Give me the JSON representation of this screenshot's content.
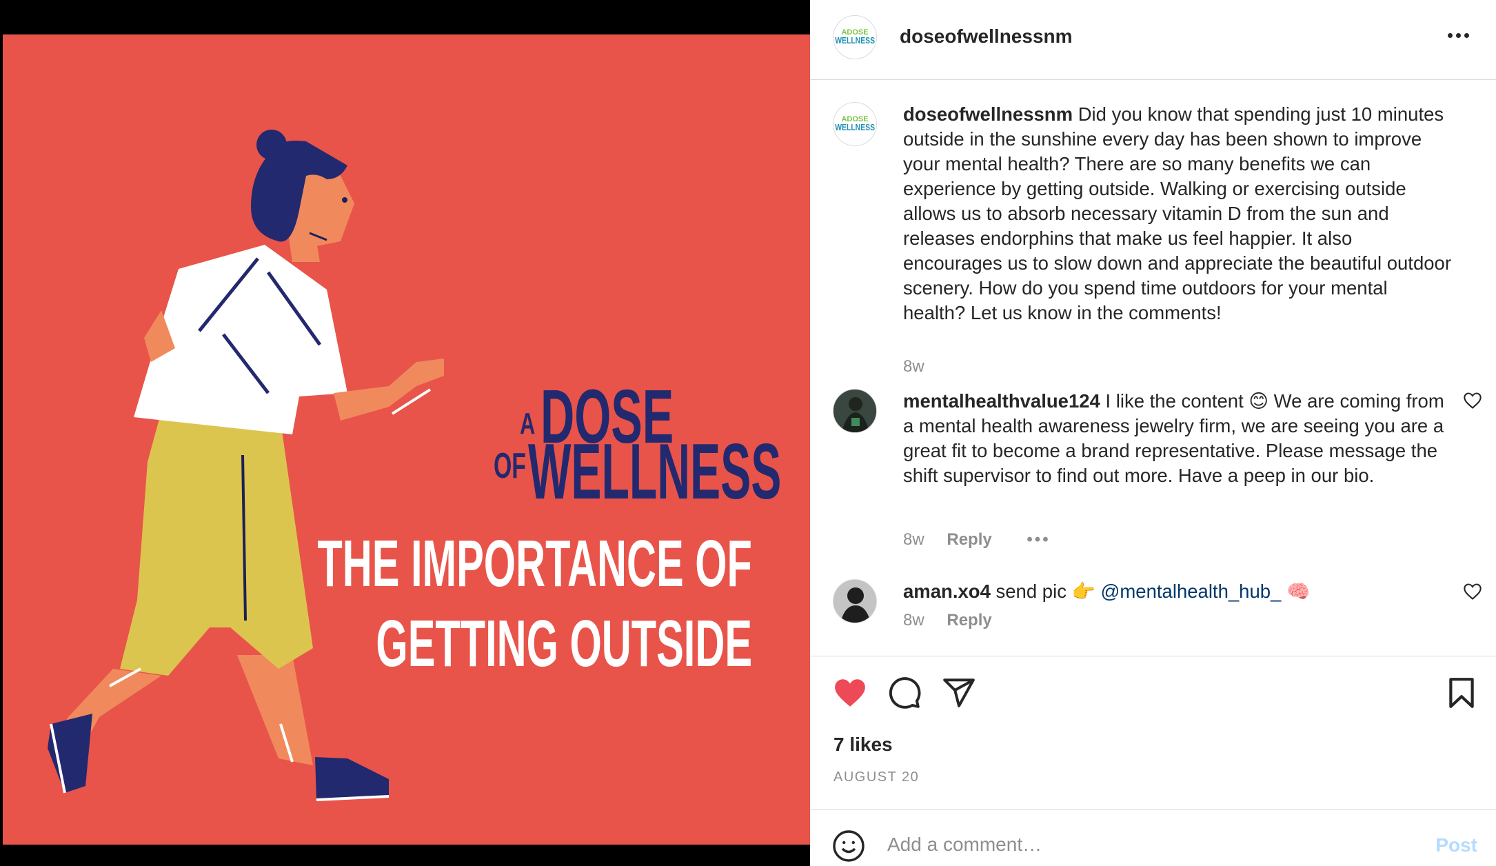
{
  "media": {
    "brand_a": "A",
    "brand_dose": "DOSE",
    "brand_of": "OF",
    "brand_wellness": "WELLNESS",
    "headline_line1": "THE IMPORTANCE OF",
    "headline_line2": "GETTING OUTSIDE",
    "background_color": "#e8544a",
    "brand_color": "#23296e"
  },
  "header": {
    "username": "doseofwellnessnm",
    "avatar_logo_top": "ADOSE",
    "avatar_logo_bottom": "WELLNESS"
  },
  "caption": {
    "username": "doseofwellnessnm",
    "text": "Did you know that spending just 10 minutes outside in the sunshine every day has been shown to improve your mental health? There are so many benefits we can experience by getting outside. Walking or exercising outside allows us to absorb necessary vitamin D from the sun and releases endorphins that make us feel happier. It also encourages us to slow down and appreciate the beautiful outdoor scenery. How do you spend time outdoors for your mental health? Let us know in the comments!",
    "time": "8w"
  },
  "comments": [
    {
      "username": "mentalhealthvalue124",
      "text_before_emoji": "I like the content ",
      "emoji": "😊",
      "text_after_emoji": " We are coming from a mental health awareness jewelry firm, we are seeing you are a great fit to become a brand representative. Please message the shift supervisor to find out more. Have a peep in our bio.",
      "time": "8w",
      "reply_label": "Reply",
      "more": "•••"
    },
    {
      "username": "aman.xo4",
      "text_before": "send pic ",
      "emoji_point": "👉",
      "mention": "@mentalhealth_hub_",
      "emoji_brain": "🧠",
      "time": "8w",
      "reply_label": "Reply"
    }
  ],
  "actions": {
    "likes": "7 likes",
    "date": "AUGUST 20",
    "like_color": "#ed4956"
  },
  "add_comment": {
    "placeholder": "Add a comment…",
    "post_label": "Post",
    "post_color": "#b3dbff"
  }
}
